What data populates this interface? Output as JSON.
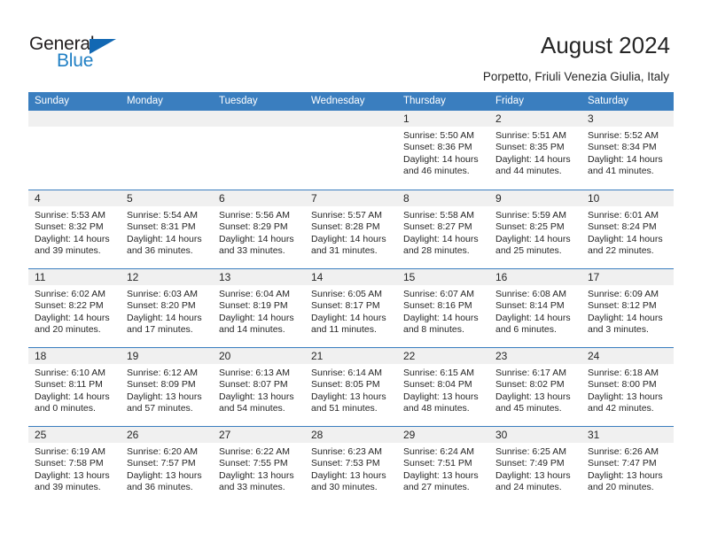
{
  "brand": {
    "name_dark": "General",
    "name_blue": "Blue",
    "accent_blue": "#1f7fc4",
    "triangle_blue": "#1268b3"
  },
  "header": {
    "title": "August 2024",
    "subtitle": "Porpetto, Friuli Venezia Giulia, Italy"
  },
  "theme": {
    "header_bar": "#3a7ebf",
    "daynum_band": "#f0f0f0",
    "text": "#262626"
  },
  "weekdays": [
    "Sunday",
    "Monday",
    "Tuesday",
    "Wednesday",
    "Thursday",
    "Friday",
    "Saturday"
  ],
  "weeks": [
    [
      {
        "day": "",
        "lines": []
      },
      {
        "day": "",
        "lines": []
      },
      {
        "day": "",
        "lines": []
      },
      {
        "day": "",
        "lines": []
      },
      {
        "day": "1",
        "lines": [
          "Sunrise: 5:50 AM",
          "Sunset: 8:36 PM",
          "Daylight: 14 hours",
          "and 46 minutes."
        ]
      },
      {
        "day": "2",
        "lines": [
          "Sunrise: 5:51 AM",
          "Sunset: 8:35 PM",
          "Daylight: 14 hours",
          "and 44 minutes."
        ]
      },
      {
        "day": "3",
        "lines": [
          "Sunrise: 5:52 AM",
          "Sunset: 8:34 PM",
          "Daylight: 14 hours",
          "and 41 minutes."
        ]
      }
    ],
    [
      {
        "day": "4",
        "lines": [
          "Sunrise: 5:53 AM",
          "Sunset: 8:32 PM",
          "Daylight: 14 hours",
          "and 39 minutes."
        ]
      },
      {
        "day": "5",
        "lines": [
          "Sunrise: 5:54 AM",
          "Sunset: 8:31 PM",
          "Daylight: 14 hours",
          "and 36 minutes."
        ]
      },
      {
        "day": "6",
        "lines": [
          "Sunrise: 5:56 AM",
          "Sunset: 8:29 PM",
          "Daylight: 14 hours",
          "and 33 minutes."
        ]
      },
      {
        "day": "7",
        "lines": [
          "Sunrise: 5:57 AM",
          "Sunset: 8:28 PM",
          "Daylight: 14 hours",
          "and 31 minutes."
        ]
      },
      {
        "day": "8",
        "lines": [
          "Sunrise: 5:58 AM",
          "Sunset: 8:27 PM",
          "Daylight: 14 hours",
          "and 28 minutes."
        ]
      },
      {
        "day": "9",
        "lines": [
          "Sunrise: 5:59 AM",
          "Sunset: 8:25 PM",
          "Daylight: 14 hours",
          "and 25 minutes."
        ]
      },
      {
        "day": "10",
        "lines": [
          "Sunrise: 6:01 AM",
          "Sunset: 8:24 PM",
          "Daylight: 14 hours",
          "and 22 minutes."
        ]
      }
    ],
    [
      {
        "day": "11",
        "lines": [
          "Sunrise: 6:02 AM",
          "Sunset: 8:22 PM",
          "Daylight: 14 hours",
          "and 20 minutes."
        ]
      },
      {
        "day": "12",
        "lines": [
          "Sunrise: 6:03 AM",
          "Sunset: 8:20 PM",
          "Daylight: 14 hours",
          "and 17 minutes."
        ]
      },
      {
        "day": "13",
        "lines": [
          "Sunrise: 6:04 AM",
          "Sunset: 8:19 PM",
          "Daylight: 14 hours",
          "and 14 minutes."
        ]
      },
      {
        "day": "14",
        "lines": [
          "Sunrise: 6:05 AM",
          "Sunset: 8:17 PM",
          "Daylight: 14 hours",
          "and 11 minutes."
        ]
      },
      {
        "day": "15",
        "lines": [
          "Sunrise: 6:07 AM",
          "Sunset: 8:16 PM",
          "Daylight: 14 hours",
          "and 8 minutes."
        ]
      },
      {
        "day": "16",
        "lines": [
          "Sunrise: 6:08 AM",
          "Sunset: 8:14 PM",
          "Daylight: 14 hours",
          "and 6 minutes."
        ]
      },
      {
        "day": "17",
        "lines": [
          "Sunrise: 6:09 AM",
          "Sunset: 8:12 PM",
          "Daylight: 14 hours",
          "and 3 minutes."
        ]
      }
    ],
    [
      {
        "day": "18",
        "lines": [
          "Sunrise: 6:10 AM",
          "Sunset: 8:11 PM",
          "Daylight: 14 hours",
          "and 0 minutes."
        ]
      },
      {
        "day": "19",
        "lines": [
          "Sunrise: 6:12 AM",
          "Sunset: 8:09 PM",
          "Daylight: 13 hours",
          "and 57 minutes."
        ]
      },
      {
        "day": "20",
        "lines": [
          "Sunrise: 6:13 AM",
          "Sunset: 8:07 PM",
          "Daylight: 13 hours",
          "and 54 minutes."
        ]
      },
      {
        "day": "21",
        "lines": [
          "Sunrise: 6:14 AM",
          "Sunset: 8:05 PM",
          "Daylight: 13 hours",
          "and 51 minutes."
        ]
      },
      {
        "day": "22",
        "lines": [
          "Sunrise: 6:15 AM",
          "Sunset: 8:04 PM",
          "Daylight: 13 hours",
          "and 48 minutes."
        ]
      },
      {
        "day": "23",
        "lines": [
          "Sunrise: 6:17 AM",
          "Sunset: 8:02 PM",
          "Daylight: 13 hours",
          "and 45 minutes."
        ]
      },
      {
        "day": "24",
        "lines": [
          "Sunrise: 6:18 AM",
          "Sunset: 8:00 PM",
          "Daylight: 13 hours",
          "and 42 minutes."
        ]
      }
    ],
    [
      {
        "day": "25",
        "lines": [
          "Sunrise: 6:19 AM",
          "Sunset: 7:58 PM",
          "Daylight: 13 hours",
          "and 39 minutes."
        ]
      },
      {
        "day": "26",
        "lines": [
          "Sunrise: 6:20 AM",
          "Sunset: 7:57 PM",
          "Daylight: 13 hours",
          "and 36 minutes."
        ]
      },
      {
        "day": "27",
        "lines": [
          "Sunrise: 6:22 AM",
          "Sunset: 7:55 PM",
          "Daylight: 13 hours",
          "and 33 minutes."
        ]
      },
      {
        "day": "28",
        "lines": [
          "Sunrise: 6:23 AM",
          "Sunset: 7:53 PM",
          "Daylight: 13 hours",
          "and 30 minutes."
        ]
      },
      {
        "day": "29",
        "lines": [
          "Sunrise: 6:24 AM",
          "Sunset: 7:51 PM",
          "Daylight: 13 hours",
          "and 27 minutes."
        ]
      },
      {
        "day": "30",
        "lines": [
          "Sunrise: 6:25 AM",
          "Sunset: 7:49 PM",
          "Daylight: 13 hours",
          "and 24 minutes."
        ]
      },
      {
        "day": "31",
        "lines": [
          "Sunrise: 6:26 AM",
          "Sunset: 7:47 PM",
          "Daylight: 13 hours",
          "and 20 minutes."
        ]
      }
    ]
  ]
}
